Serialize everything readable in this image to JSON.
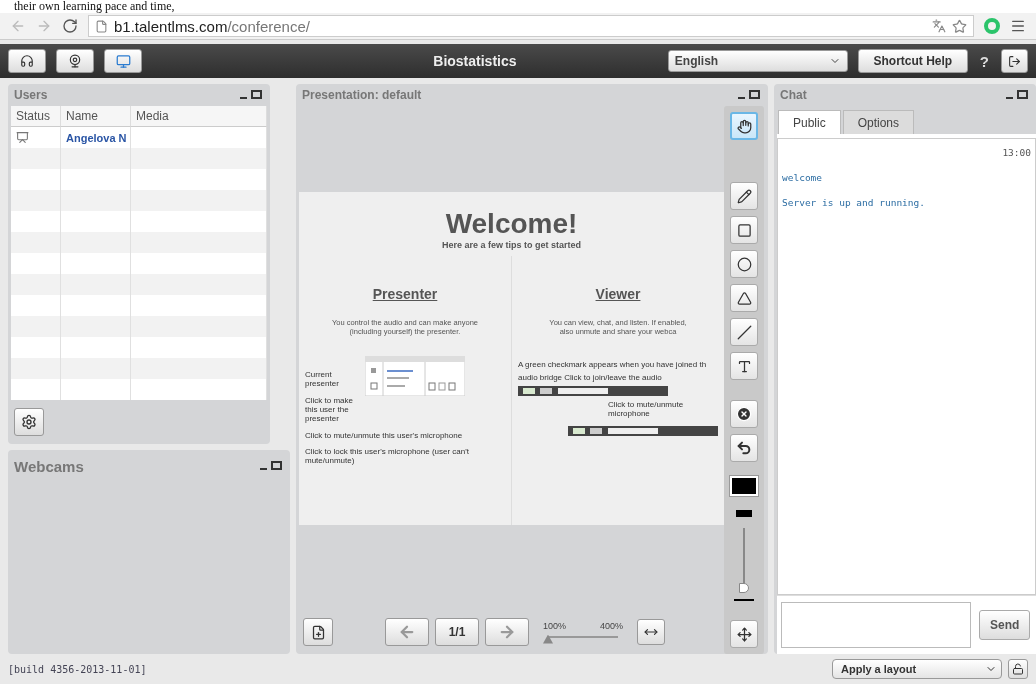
{
  "page_caption": "their own learning pace and time,",
  "browser": {
    "url_host": "b1.talentlms.com",
    "url_path": "/conference/"
  },
  "toolbar": {
    "title": "Biostatistics",
    "language": "English",
    "shortcut_help": "Shortcut Help",
    "help": "?"
  },
  "users": {
    "title": "Users",
    "columns": [
      "Status",
      "Name",
      "Media"
    ],
    "rows": [
      {
        "presenter": true,
        "name": "Angelova N"
      }
    ]
  },
  "webcams": {
    "title": "Webcams"
  },
  "presentation": {
    "title": "Presentation: default",
    "slide": {
      "title": "Welcome!",
      "subtitle": "Here are a few tips to get started",
      "presenter": {
        "heading": "Presenter",
        "lines": [
          "You control the audio and can make anyone",
          "(including yourself) the presenter."
        ],
        "callout_current": "Current presenter",
        "callout_make": "Click to make this user the presenter",
        "callout_mute": "Click to mute/unmute this user's microphone",
        "callout_lock": "Click to lock this user's microphone (user can't mute/unmute)"
      },
      "viewer": {
        "heading": "Viewer",
        "lines": [
          "You can view, chat, and listen.  If enabled,",
          "also unmute and share your webca"
        ],
        "callout_join": [
          "A green checkmark appears when you have joined th",
          "audio bridge   Click to join/leave the audio"
        ],
        "callout_mute": [
          "Click to mute/unmute",
          "microphone"
        ]
      }
    },
    "tools": [
      {
        "kind": "hand",
        "selected": true
      },
      {
        "kind": "pencil",
        "selected": false
      },
      {
        "kind": "rectangle",
        "selected": false
      },
      {
        "kind": "ellipse",
        "selected": false
      },
      {
        "kind": "triangle",
        "selected": false
      },
      {
        "kind": "line",
        "selected": false
      },
      {
        "kind": "text",
        "selected": false
      }
    ],
    "thickness": {
      "level": 0
    },
    "page": "1/1",
    "zoom": {
      "min_label": "100%",
      "max_label": "400%",
      "level": 0
    }
  },
  "chat": {
    "title": "Chat",
    "tabs": [
      {
        "label": "Public",
        "selected": true
      },
      {
        "label": "Options",
        "selected": false
      }
    ],
    "messages": [
      {
        "kind": "time",
        "text": "13:00"
      },
      {
        "kind": "message",
        "text": "welcome"
      },
      {
        "kind": "message",
        "text": "Server is up and running."
      }
    ],
    "send": "Send"
  },
  "footer": {
    "build": "[build 4356-2013-11-01]",
    "layout": "Apply a layout"
  }
}
